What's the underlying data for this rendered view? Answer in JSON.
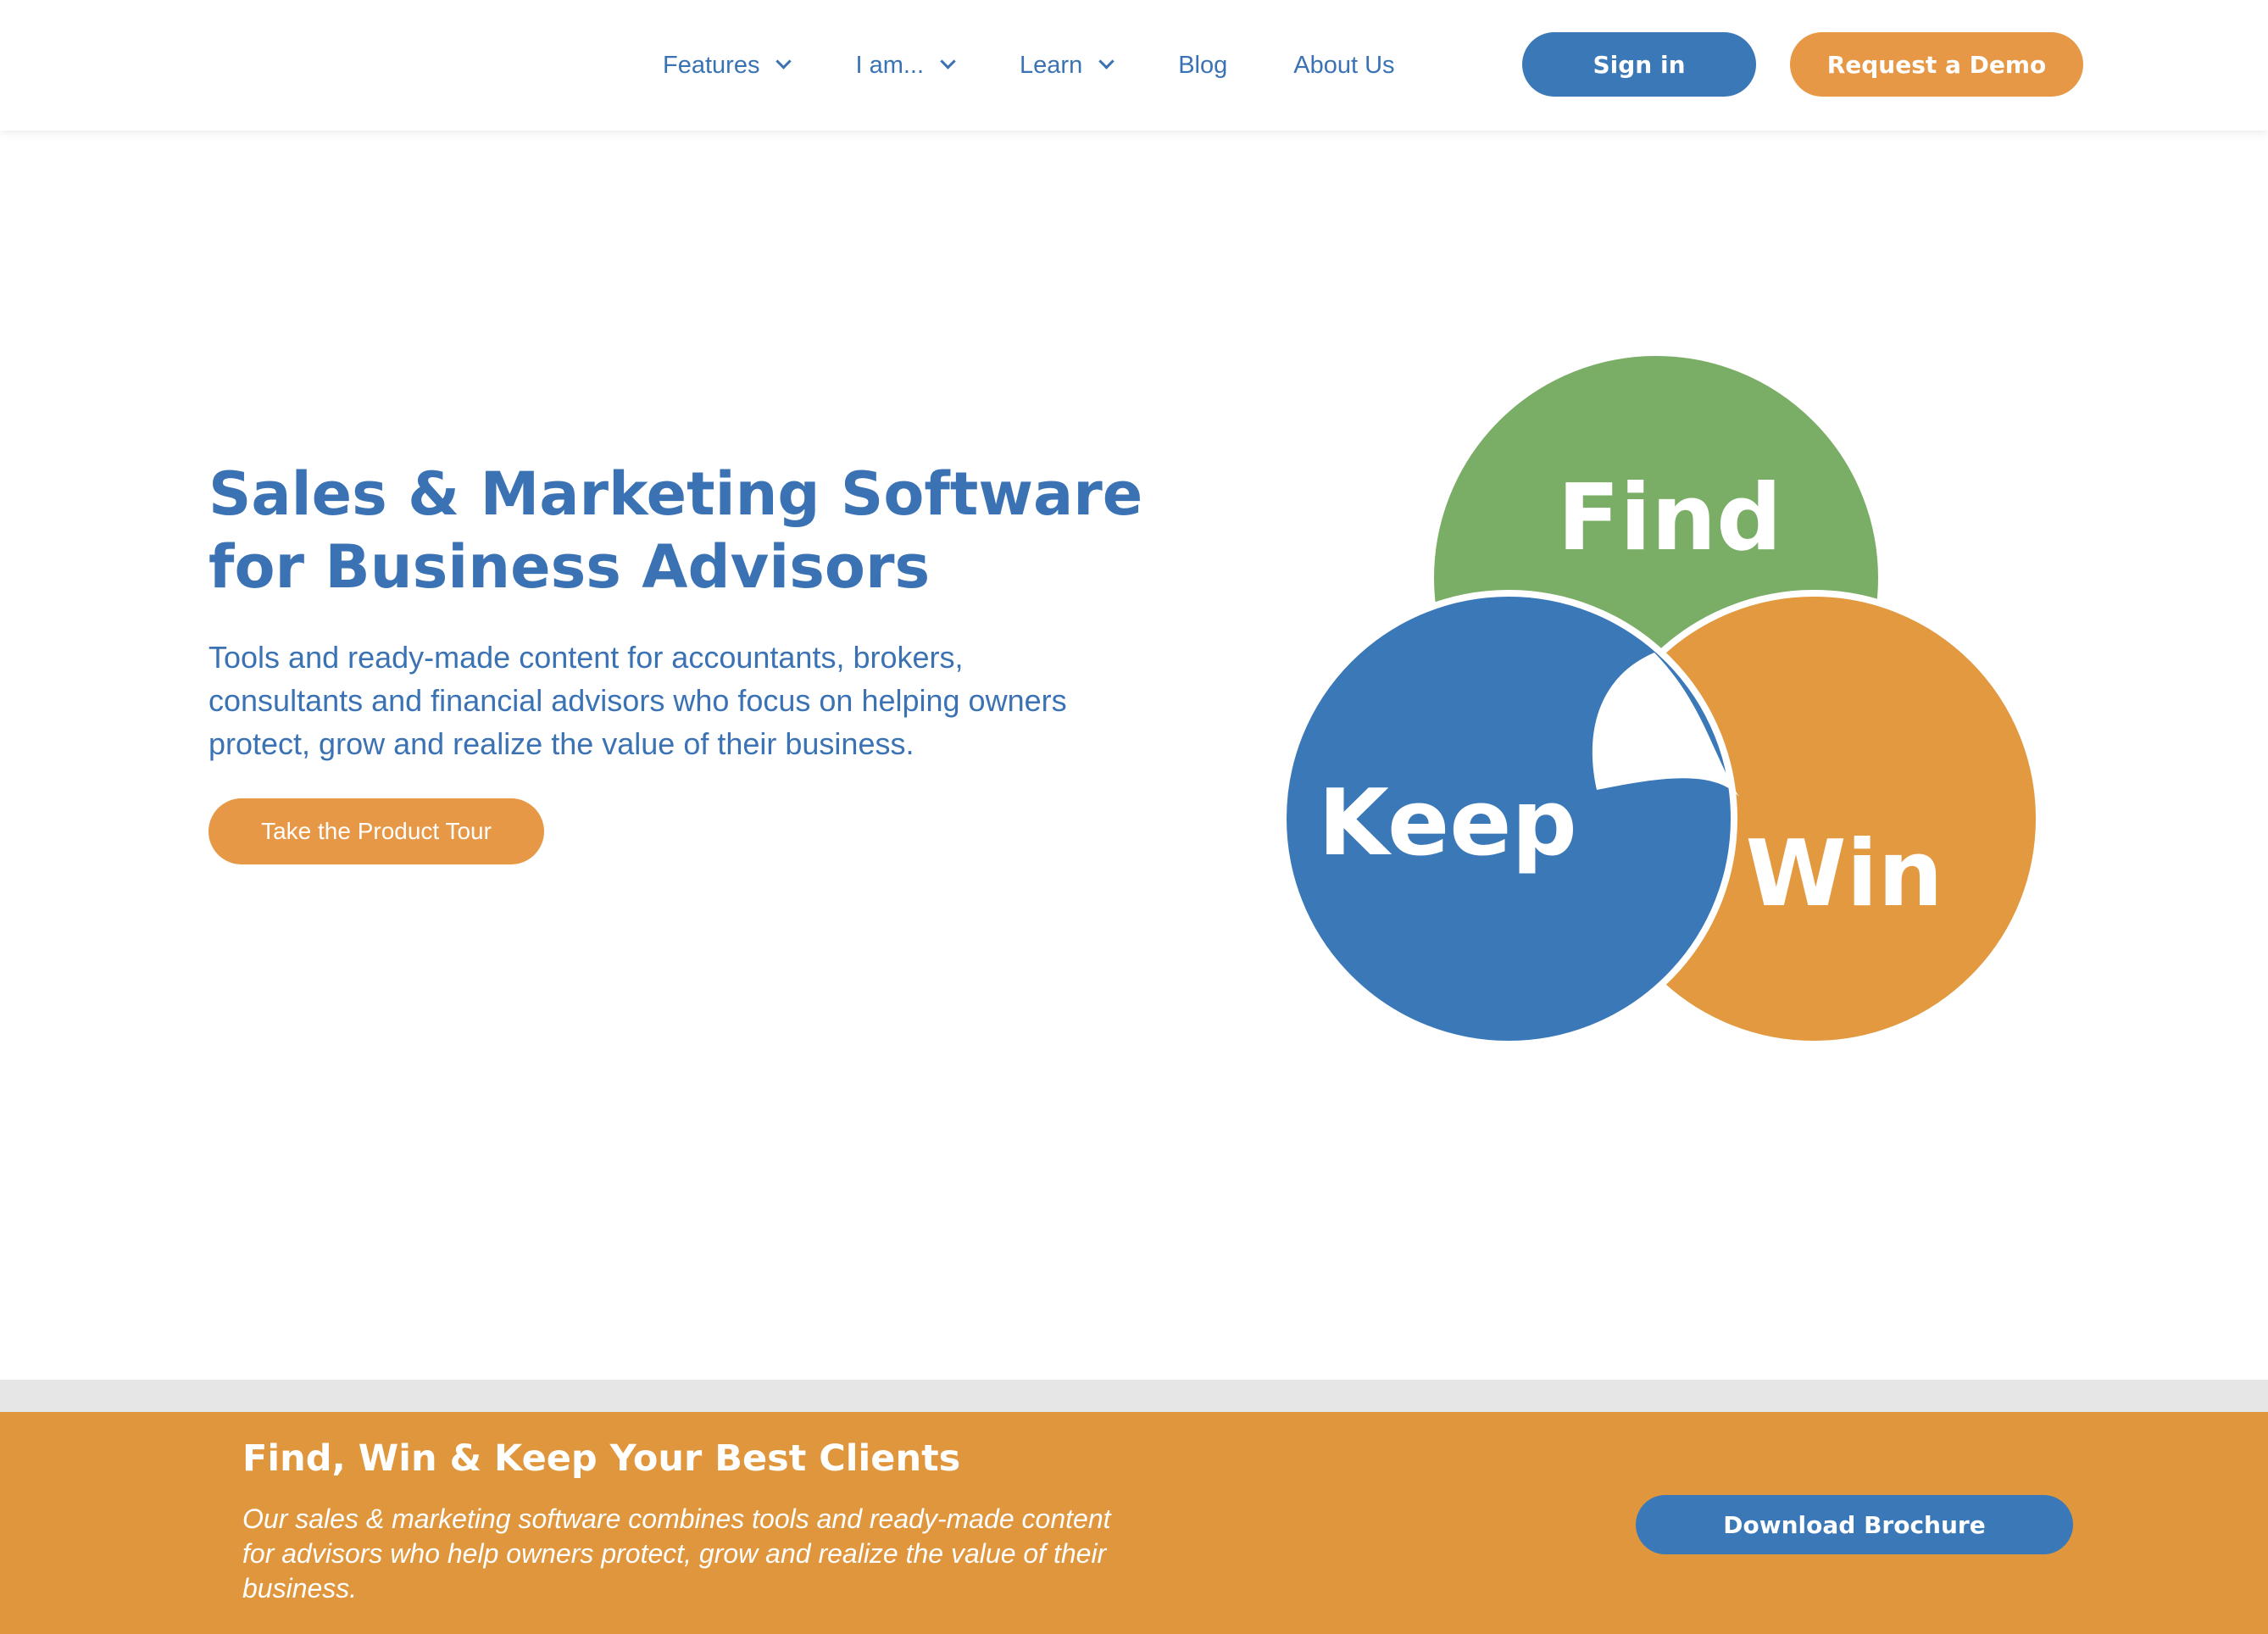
{
  "header": {
    "nav": [
      {
        "label": "Features",
        "has_dropdown": true
      },
      {
        "label": "I am...",
        "has_dropdown": true
      },
      {
        "label": "Learn",
        "has_dropdown": true
      },
      {
        "label": "Blog",
        "has_dropdown": false
      },
      {
        "label": "About Us",
        "has_dropdown": false
      }
    ],
    "signin_label": "Sign in",
    "demo_label": "Request a Demo"
  },
  "hero": {
    "title_lines": [
      "Sales & Marketing Software",
      "for Business Advisors"
    ],
    "description_lines": [
      "Tools and ready-made content for accountants, brokers,",
      "consultants and financial advisors who focus on helping owners",
      "protect, grow and realize the value of their business."
    ],
    "tour_label": "Take the Product Tour"
  },
  "graphic": {
    "find_label": "Find",
    "win_label": "Win",
    "keep_label": "Keep",
    "colors": {
      "find": "#7aad66",
      "win": "#e2993f",
      "keep": "#3a78b8"
    }
  },
  "banner": {
    "title": "Find, Win & Keep Your Best Clients",
    "text_lines": [
      "Our sales & marketing software combines tools and ready-made content",
      "for advisors who help owners protect, grow and realize the value of their",
      "business."
    ],
    "brochure_label": "Download Brochure"
  },
  "colors": {
    "brand_blue": "#3a72b4",
    "button_blue": "#3a78b8",
    "button_orange": "#e79847",
    "banner_orange": "#e0963c"
  }
}
